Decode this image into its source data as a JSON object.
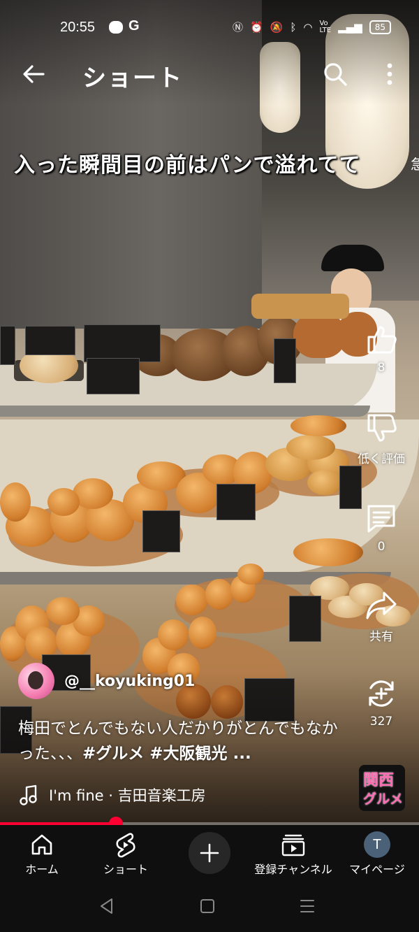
{
  "status_bar": {
    "time": "20:55",
    "left_icons": [
      "line-icon",
      "google-icon"
    ],
    "right_icons": [
      "nfc-icon",
      "alarm-icon",
      "mute-icon",
      "bluetooth-icon",
      "wifi-icon",
      "volte-icon",
      "signal-icon"
    ],
    "battery": "85"
  },
  "header": {
    "title": "ショート",
    "back_icon": "arrow-back-icon",
    "search_icon": "search-icon",
    "more_icon": "more-vert-icon"
  },
  "video": {
    "caption": "入った瞬間目の前はパンで溢れてて",
    "caption_tail": "急上"
  },
  "actions": {
    "like_count": "8",
    "dislike_label": "低く評価",
    "comment_count": "0",
    "share_label": "共有",
    "remix_count": "327"
  },
  "channel": {
    "handle": "@__koyuking01"
  },
  "description": {
    "text": "梅田でとんでもない人だかりがとんでもなかった、、、",
    "hashtags": "#グルメ #大阪観光 ..."
  },
  "music": {
    "track": "I'm fine · 吉田音楽工房"
  },
  "badge": {
    "line1": "関西",
    "line2": "グルメ"
  },
  "playback": {
    "progress": 0.277
  },
  "bottom_nav": {
    "home": "ホーム",
    "shorts": "ショート",
    "subscriptions": "登録チャンネル",
    "you": "マイページ",
    "avatar_letter": "T"
  },
  "colors": {
    "accent": "#ff0033",
    "nav_bg": "#0f0f0f"
  }
}
